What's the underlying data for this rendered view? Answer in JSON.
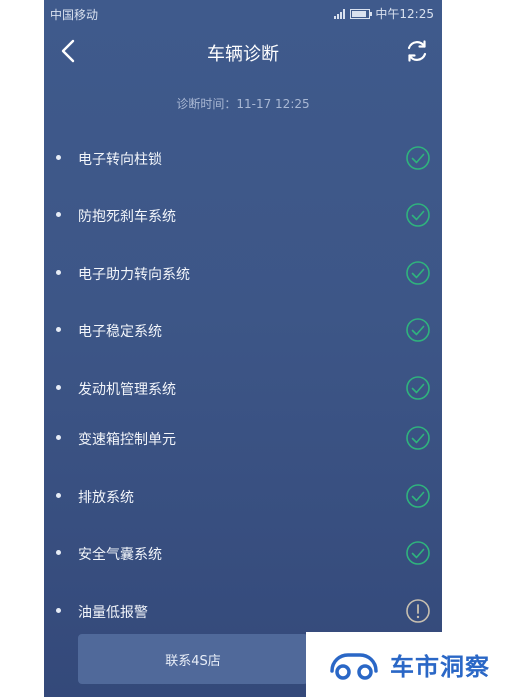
{
  "status_bar": {
    "carrier": "中国移动",
    "time": "中午12:25",
    "battery_fraction": 0.85
  },
  "header": {
    "title": "车辆诊断"
  },
  "diagnosis": {
    "time_label": "诊断时间：11-17 12:25"
  },
  "items": [
    {
      "label": "电子转向柱锁",
      "status": "ok"
    },
    {
      "label": "防抱死刹车系统",
      "status": "ok"
    },
    {
      "label": "电子助力转向系统",
      "status": "ok"
    },
    {
      "label": "电子稳定系统",
      "status": "ok"
    },
    {
      "label": "发动机管理系统",
      "status": "ok"
    },
    {
      "label": "变速箱控制单元",
      "status": "ok"
    },
    {
      "label": "排放系统",
      "status": "ok"
    },
    {
      "label": "安全气囊系统",
      "status": "ok"
    },
    {
      "label": "油量低报警",
      "status": "warning"
    }
  ],
  "contact_button": {
    "label": "联系4S店"
  },
  "watermark": {
    "text": "车市洞察"
  },
  "colors": {
    "ok": "#2fb37d",
    "warning": "#c7bfb0",
    "accent": "#2a67c6"
  },
  "icons": {
    "ok": "check-circle-icon",
    "warning": "exclamation-circle-icon",
    "back": "chevron-left-icon",
    "refresh": "refresh-icon"
  }
}
